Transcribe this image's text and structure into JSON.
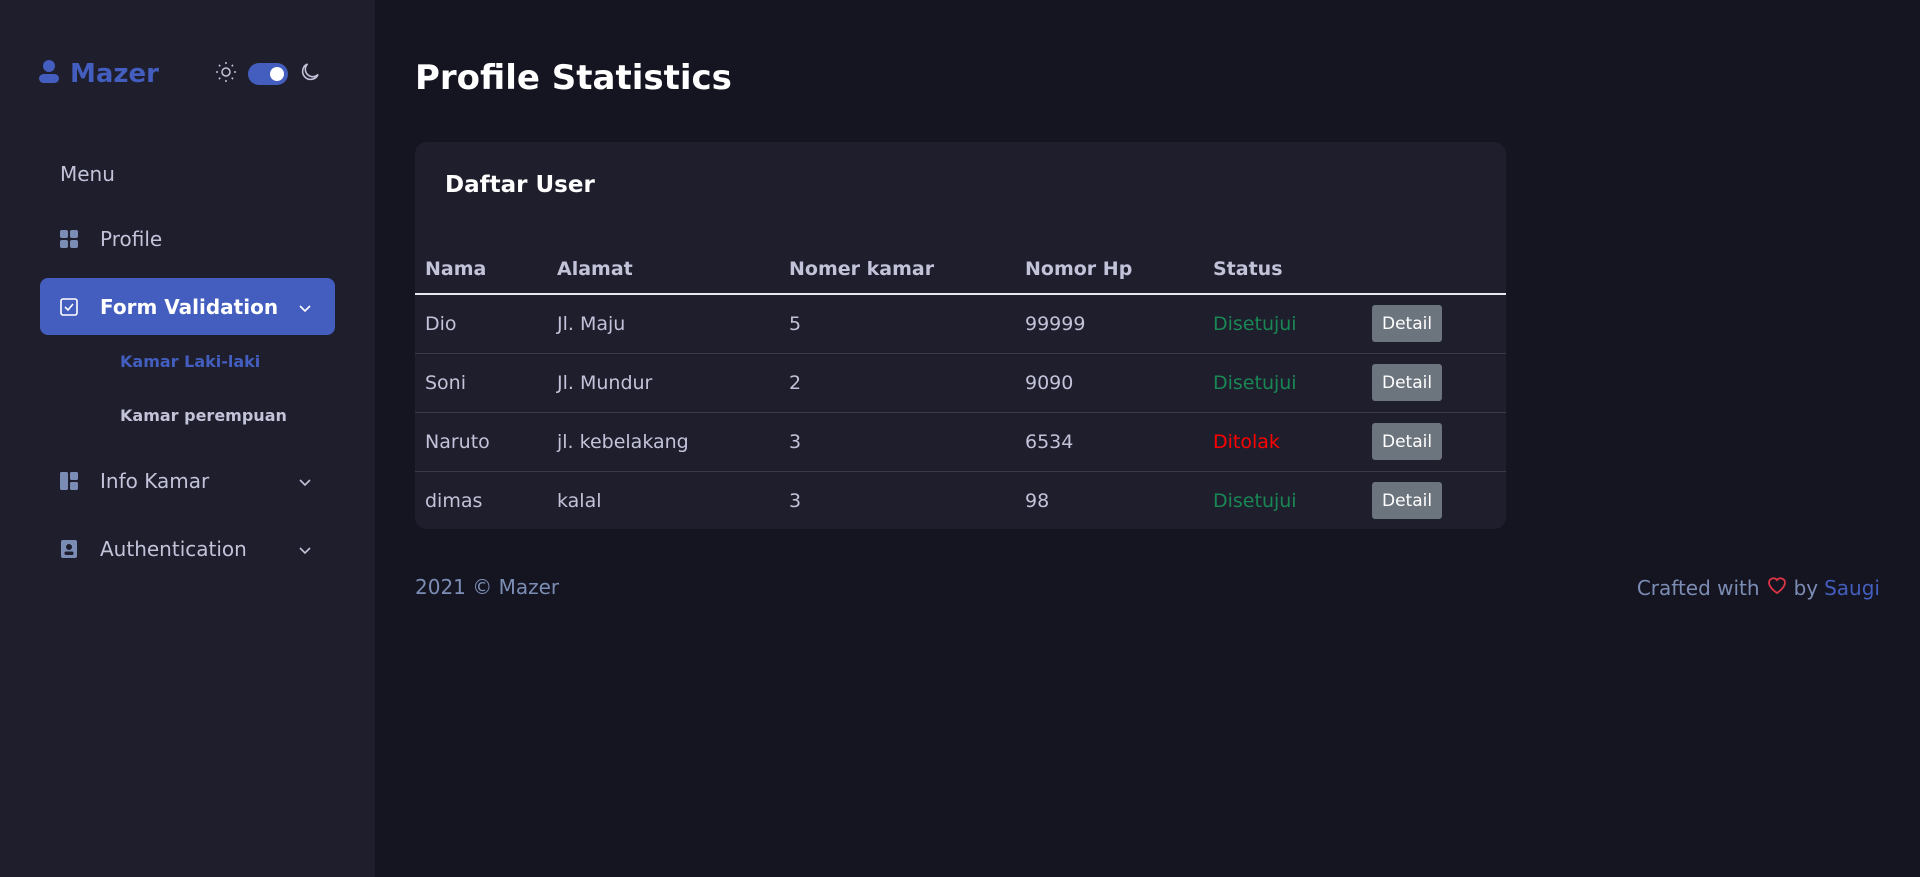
{
  "brand": {
    "name": "Mazer"
  },
  "sidebar": {
    "menu_title": "Menu",
    "items": [
      {
        "label": "Profile",
        "icon": "grid-icon"
      },
      {
        "label": "Form Validation",
        "icon": "checklist-icon",
        "active": true
      },
      {
        "label": "Info Kamar",
        "icon": "layout-icon"
      },
      {
        "label": "Authentication",
        "icon": "id-badge-icon"
      }
    ],
    "submenu": [
      {
        "label": "Kamar Laki-laki",
        "active": true
      },
      {
        "label": "Kamar perempuan"
      }
    ]
  },
  "page": {
    "title": "Profile Statistics"
  },
  "card": {
    "title": "Daftar User",
    "columns": [
      "Nama",
      "Alamat",
      "Nomer kamar",
      "Nomor Hp",
      "Status",
      ""
    ],
    "rows": [
      {
        "nama": "Dio",
        "alamat": "Jl. Maju",
        "kamar": "5",
        "hp": "99999",
        "status": "Disetujui",
        "action": "Detail"
      },
      {
        "nama": "Soni",
        "alamat": "Jl. Mundur",
        "kamar": "2",
        "hp": "9090",
        "status": "Disetujui",
        "action": "Detail"
      },
      {
        "nama": "Naruto",
        "alamat": "jl. kebelakang",
        "kamar": "3",
        "hp": "6534",
        "status": "Ditolak",
        "action": "Detail"
      },
      {
        "nama": "dimas",
        "alamat": "kalal",
        "kamar": "3",
        "hp": "98",
        "status": "Disetujui",
        "action": "Detail"
      }
    ]
  },
  "footer": {
    "copyright": "2021 © Mazer",
    "crafted_prefix": "Crafted with",
    "crafted_by": "by",
    "author": "Saugi"
  },
  "colors": {
    "accent": "#435ebe",
    "approved": "#198754",
    "rejected": "#ff0000",
    "background": "#151521",
    "sidebar": "#1e1e2d"
  }
}
